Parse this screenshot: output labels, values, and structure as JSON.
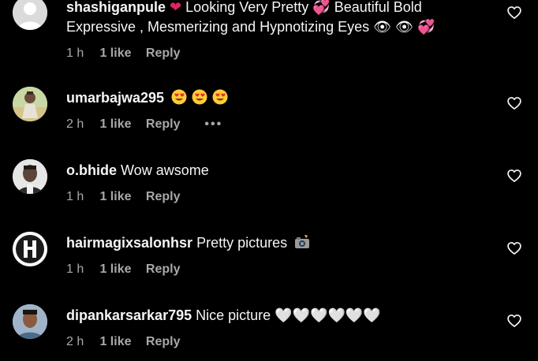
{
  "comments": [
    {
      "username": "shashiganpule",
      "text_line1_parts": [
        "❤",
        "Looking Very Pretty",
        "💞",
        "Beautiful Bold"
      ],
      "text_line2": "Expressive , Mesmerizing and Hypnotizing Eyes",
      "text_line2_emojis": [
        "👁",
        "👁",
        "💞"
      ],
      "time": "1 h",
      "likes": "1 like",
      "reply": "Reply",
      "avatar": "default-avatar"
    },
    {
      "username": "umarbajwa295",
      "text": "",
      "emojis": [
        "heart-eyes",
        "heart-eyes",
        "heart-eyes"
      ],
      "time": "2 h",
      "likes": "1 like",
      "reply": "Reply",
      "more": "•••",
      "avatar": "photo-avatar"
    },
    {
      "username": "o.bhide",
      "text": "Wow awsome",
      "time": "1 h",
      "likes": "1 like",
      "reply": "Reply",
      "avatar": "photo-avatar"
    },
    {
      "username": "hairmagixsalonhsr",
      "text": "Pretty pictures",
      "emojis": [
        "camera"
      ],
      "time": "1 h",
      "likes": "1 like",
      "reply": "Reply",
      "avatar": "logo-avatar"
    },
    {
      "username": "dipankarsarkar795",
      "text": "Nice picture",
      "emojis": [
        "🤍",
        "🤍",
        "🤍",
        "🤍",
        "🤍",
        "🤍"
      ],
      "time": "2 h",
      "likes": "1 like",
      "reply": "Reply",
      "avatar": "photo-avatar"
    }
  ],
  "icons": {
    "like": "heart-outline-icon"
  },
  "colors": {
    "background": "#000000",
    "text": "#f5f5f5",
    "meta": "#a8a8a8",
    "heart_red": "#e0245e"
  }
}
